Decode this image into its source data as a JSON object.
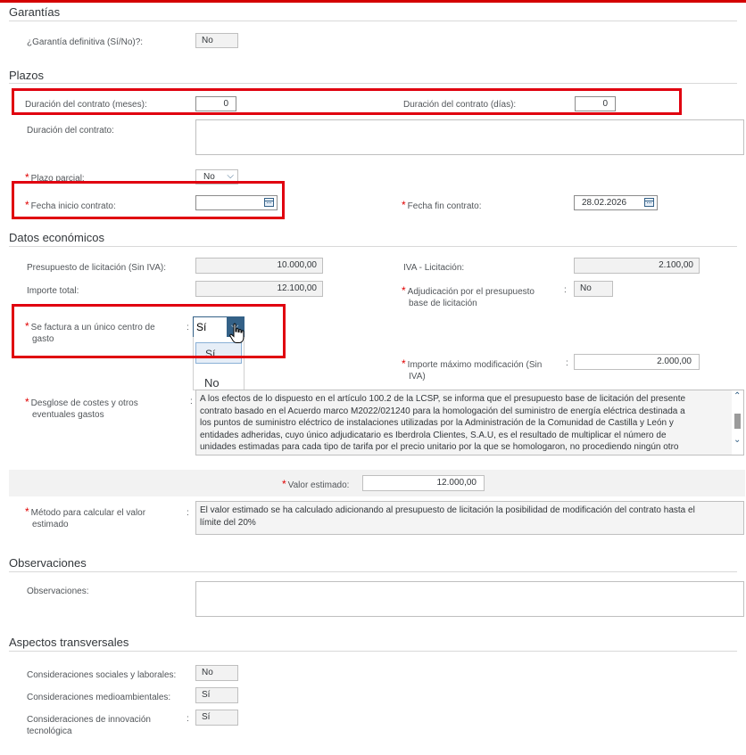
{
  "sections": {
    "garantias": "Garantías",
    "plazos": "Plazos",
    "datos": "Datos económicos",
    "observaciones": "Observaciones",
    "aspectos": "Aspectos transversales"
  },
  "garantias": {
    "label": "¿Garantía definitiva (Sí/No)?:",
    "value": "No"
  },
  "plazos": {
    "meses_label": "Duración del contrato (meses):",
    "meses_value": "0",
    "dias_label": "Duración del contrato (días):",
    "dias_value": "0",
    "duracion_label": "Duración del contrato:",
    "duracion_value": "",
    "plazo_parcial_label": "Plazo parcial:",
    "plazo_parcial_value": "No",
    "fecha_inicio_label": "Fecha inicio contrato:",
    "fecha_inicio_value": "",
    "fecha_fin_label": "Fecha fin contrato:",
    "fecha_fin_value": "28.02.2026"
  },
  "datos": {
    "presupuesto_label": "Presupuesto de licitación (Sin IVA):",
    "presupuesto_value": "10.000,00",
    "iva_label": "IVA - Licitación:",
    "iva_value": "2.100,00",
    "importe_total_label": "Importe total:",
    "importe_total_value": "12.100,00",
    "adjudicacion_label_1": "Adjudicación por el presupuesto",
    "adjudicacion_label_2": "base de licitación",
    "adjudicacion_value": "No",
    "factura_label_1": "Se factura a un único centro de",
    "factura_label_2": "gasto",
    "factura_value": "Sí",
    "factura_options": [
      "Sí",
      "No"
    ],
    "importe_max_label_1": "Importe máximo modificación (Sin",
    "importe_max_label_2": "IVA)",
    "importe_max_value": "2.000,00",
    "desglose_label_1": "Desglose de costes y otros",
    "desglose_label_2": "eventuales gastos",
    "desglose_lines": [
      "A los efectos de lo dispuesto en el artículo 100.2 de la LCSP, se informa que el presupuesto base de licitación del presente",
      "contrato basado en el Acuerdo marco M2022/021240 para la homologación del suministro de energía eléctrica destinada a",
      "los puntos de suministro eléctrico de instalaciones utilizadas por la Administración de la Comunidad de Castilla y León y",
      "entidades adheridas, cuyo único adjudicatario es Iberdrola Clientes, S.A.U, es el resultado de multiplicar el número de",
      "unidades estimadas para cada tipo de tarifa por el precio unitario por la que se homologaron, no procediendo ningún otro"
    ],
    "valor_estimado_label": "Valor estimado:",
    "valor_estimado_value": "12.000,00",
    "metodo_label_1": "Método para calcular el valor",
    "metodo_label_2": "estimado",
    "metodo_line_1": "El valor estimado se ha calculado adicionando al presupuesto de licitación la posibilidad de modificación del contrato hasta el",
    "metodo_line_2": "límite del 20%"
  },
  "observaciones": {
    "label": "Observaciones:",
    "value": ""
  },
  "aspectos": {
    "sociales_label": "Consideraciones sociales y laborales:",
    "sociales_value": "No",
    "medio_label": "Consideraciones medioambientales:",
    "medio_value": "Sí",
    "innovacion_label_1": "Consideraciones de innovación",
    "innovacion_label_2": "tecnológica",
    "innovacion_value": "Sí"
  },
  "colors": {
    "highlight": "#e0000f",
    "accent": "#346187"
  }
}
